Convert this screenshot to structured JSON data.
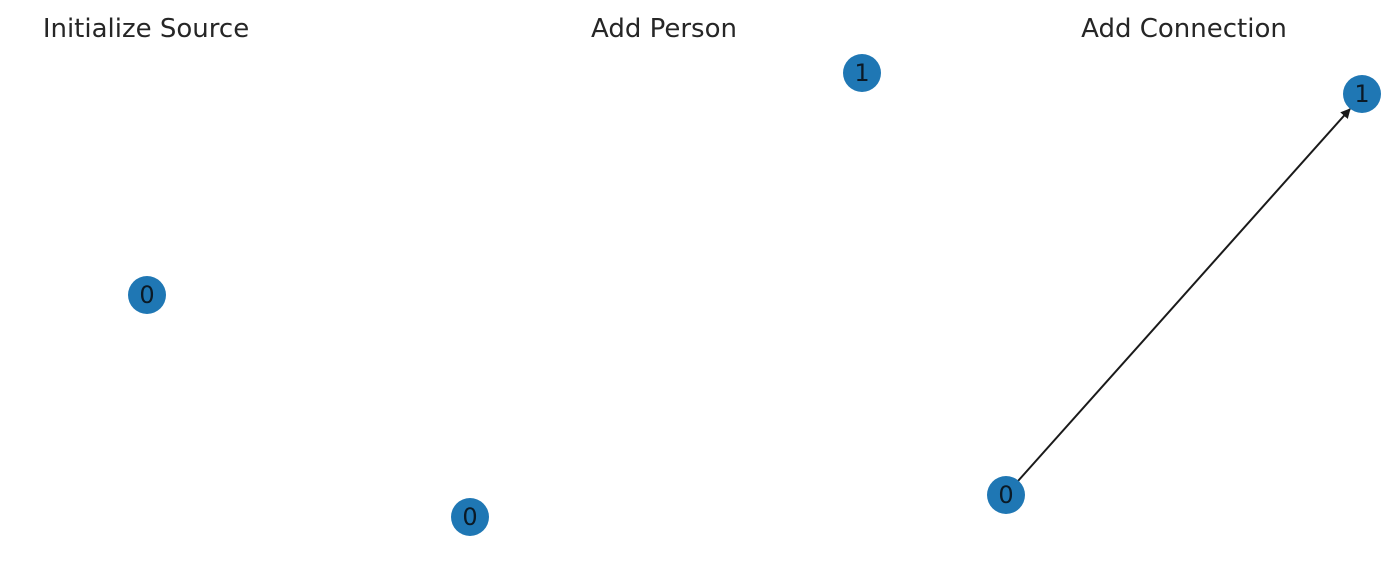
{
  "panels": [
    {
      "title": "Initialize Source",
      "nodes": [
        {
          "id": "0",
          "label": "0"
        }
      ],
      "edges": []
    },
    {
      "title": "Add Person",
      "nodes": [
        {
          "id": "0",
          "label": "0"
        },
        {
          "id": "1",
          "label": "1"
        }
      ],
      "edges": []
    },
    {
      "title": "Add Connection",
      "nodes": [
        {
          "id": "0",
          "label": "0"
        },
        {
          "id": "1",
          "label": "1"
        }
      ],
      "edges": [
        {
          "from": "0",
          "to": "1",
          "directed": true
        }
      ]
    }
  ],
  "colors": {
    "node_fill": "#1f77b4",
    "edge": "#1a1a1a",
    "title": "#262626"
  }
}
